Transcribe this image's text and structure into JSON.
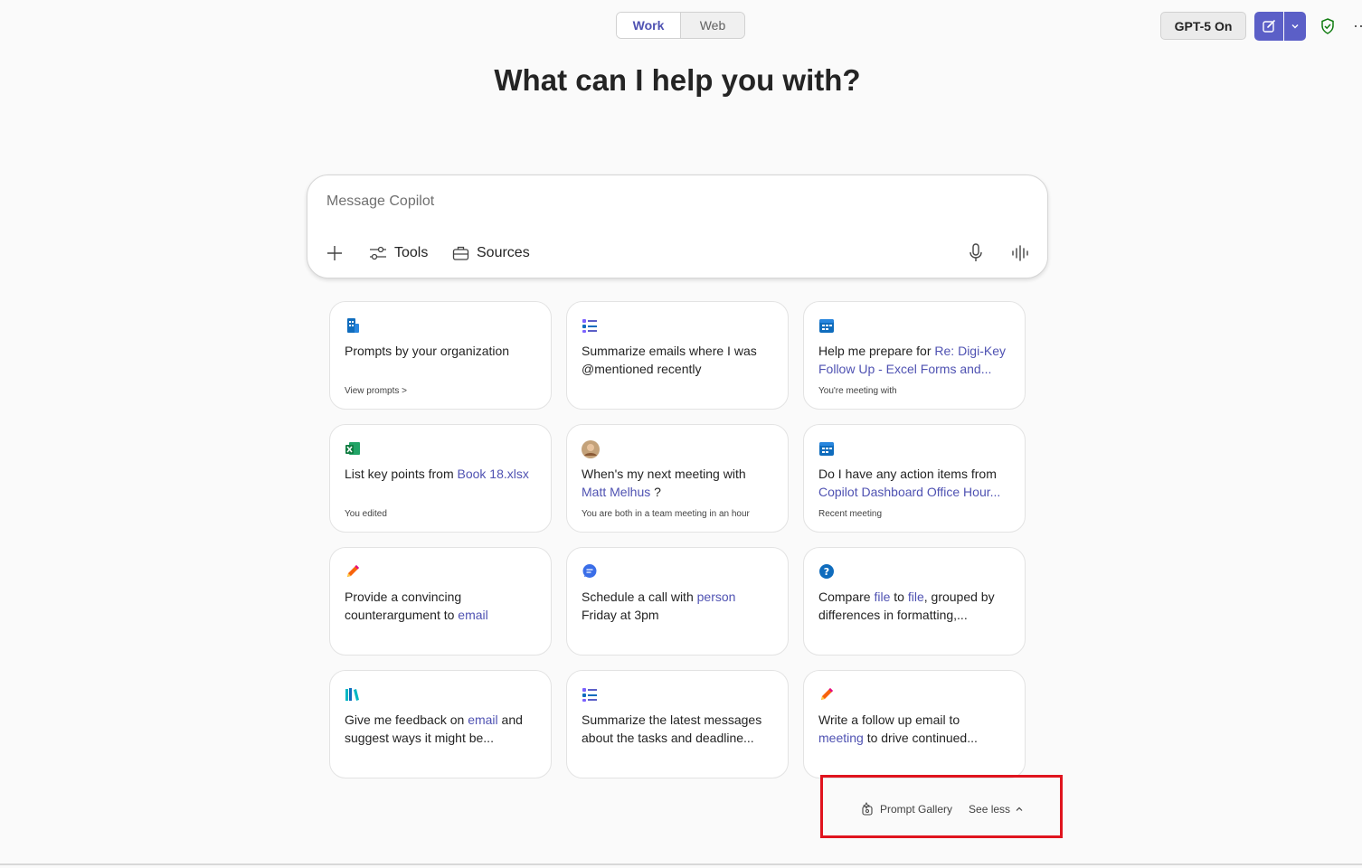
{
  "header": {
    "mode_tabs": [
      "Work",
      "Web"
    ],
    "model_label": "GPT-5 On",
    "more_label": "···"
  },
  "main": {
    "title": "What can I help you with?"
  },
  "composer": {
    "placeholder": "Message Copilot",
    "tools_label": "Tools",
    "sources_label": "Sources"
  },
  "cards": [
    {
      "icon": "building-icon",
      "l1": "Prompts by your organization",
      "l2": "",
      "sub": "View prompts >"
    },
    {
      "icon": "list-icon",
      "l1": "Summarize emails where I was",
      "l2": "@mentioned recently",
      "sub": ""
    },
    {
      "icon": "calendar-icon",
      "pre": "Help me prepare for ",
      "hl": "Re: Digi-Key",
      "l2": "Follow Up - Excel Forms and...",
      "sub": "You're meeting with"
    },
    {
      "icon": "excel-icon",
      "pre": "List key points from ",
      "hl": "Book 18.xlsx",
      "sub": "You edited"
    },
    {
      "icon": "avatar-icon",
      "l1": "When's my next meeting with",
      "hl": "Matt Melhus",
      "post": " ?",
      "sub": "You are both in a team meeting in an hour"
    },
    {
      "icon": "calendar-icon",
      "l1": "Do I have any action items from",
      "hl": "Copilot Dashboard Office Hour...",
      "sub": "Recent meeting"
    },
    {
      "icon": "pencil-icon",
      "l1": "Provide a convincing",
      "pre2": "counterargument to ",
      "hl": "email",
      "sub": ""
    },
    {
      "icon": "chat-bubble-icon",
      "pre": "Schedule a call with ",
      "hl": "person",
      "l2": "Friday at 3pm",
      "sub": ""
    },
    {
      "icon": "question-icon",
      "pre": "Compare ",
      "hl": "file",
      "mid": " to ",
      "hl2": "file",
      "post": ", grouped by",
      "l2": "differences in formatting,...",
      "sub": ""
    },
    {
      "icon": "books-icon",
      "pre": "Give me feedback on ",
      "hl": "email",
      "post": " and",
      "l2": "suggest ways it might be...",
      "sub": ""
    },
    {
      "icon": "list-icon",
      "l1": "Summarize the latest messages",
      "l2": "about the tasks and deadline...",
      "sub": ""
    },
    {
      "icon": "pencil-icon",
      "l1": "Write a follow up email to",
      "hl": "meeting",
      "post": " to drive continued...",
      "sub": ""
    }
  ],
  "footer": {
    "prompt_gallery_label": "Prompt Gallery",
    "see_less_label": "See less"
  },
  "colors": {
    "accent": "#5b5fc7",
    "link": "#4f52b2",
    "highlight_box": "#e0141e"
  }
}
